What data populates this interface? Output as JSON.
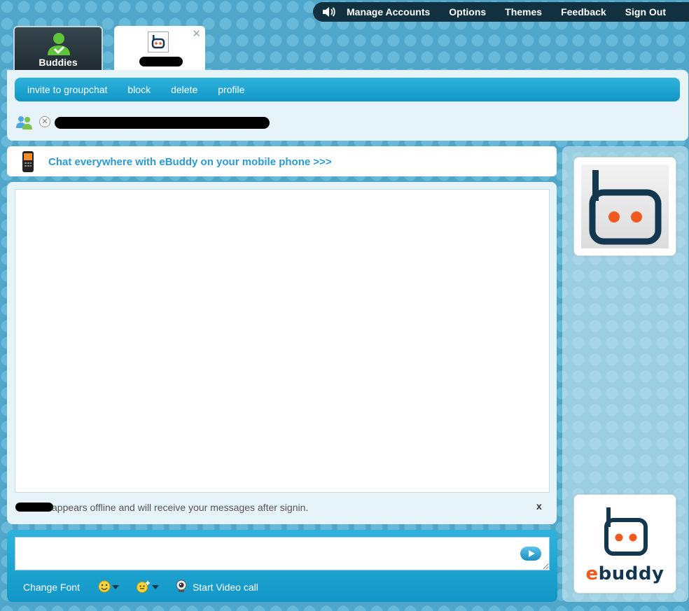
{
  "topnav": {
    "sound_icon": "speaker-icon",
    "items": [
      "Manage Accounts",
      "Options",
      "Themes",
      "Feedback",
      "Sign Out"
    ]
  },
  "tabs": {
    "buddies_label": "Buddies",
    "close_icon": "close-icon"
  },
  "actions": [
    "invite to groupchat",
    "block",
    "delete",
    "profile"
  ],
  "promo": {
    "text": "Chat everywhere with eBuddy on your mobile phone >>>"
  },
  "status": {
    "offline_text": "appears offline and will receive your messages after signin.",
    "dismiss": "x"
  },
  "composer": {
    "message_value": "",
    "change_font": "Change Font",
    "video_call": "Start Video call"
  },
  "sidebar": {
    "brand": "ebuddy"
  },
  "colors": {
    "accent": "#1a9fd0",
    "orange": "#f05a1e",
    "navy": "#13374f",
    "background": "#4fa6c8"
  }
}
